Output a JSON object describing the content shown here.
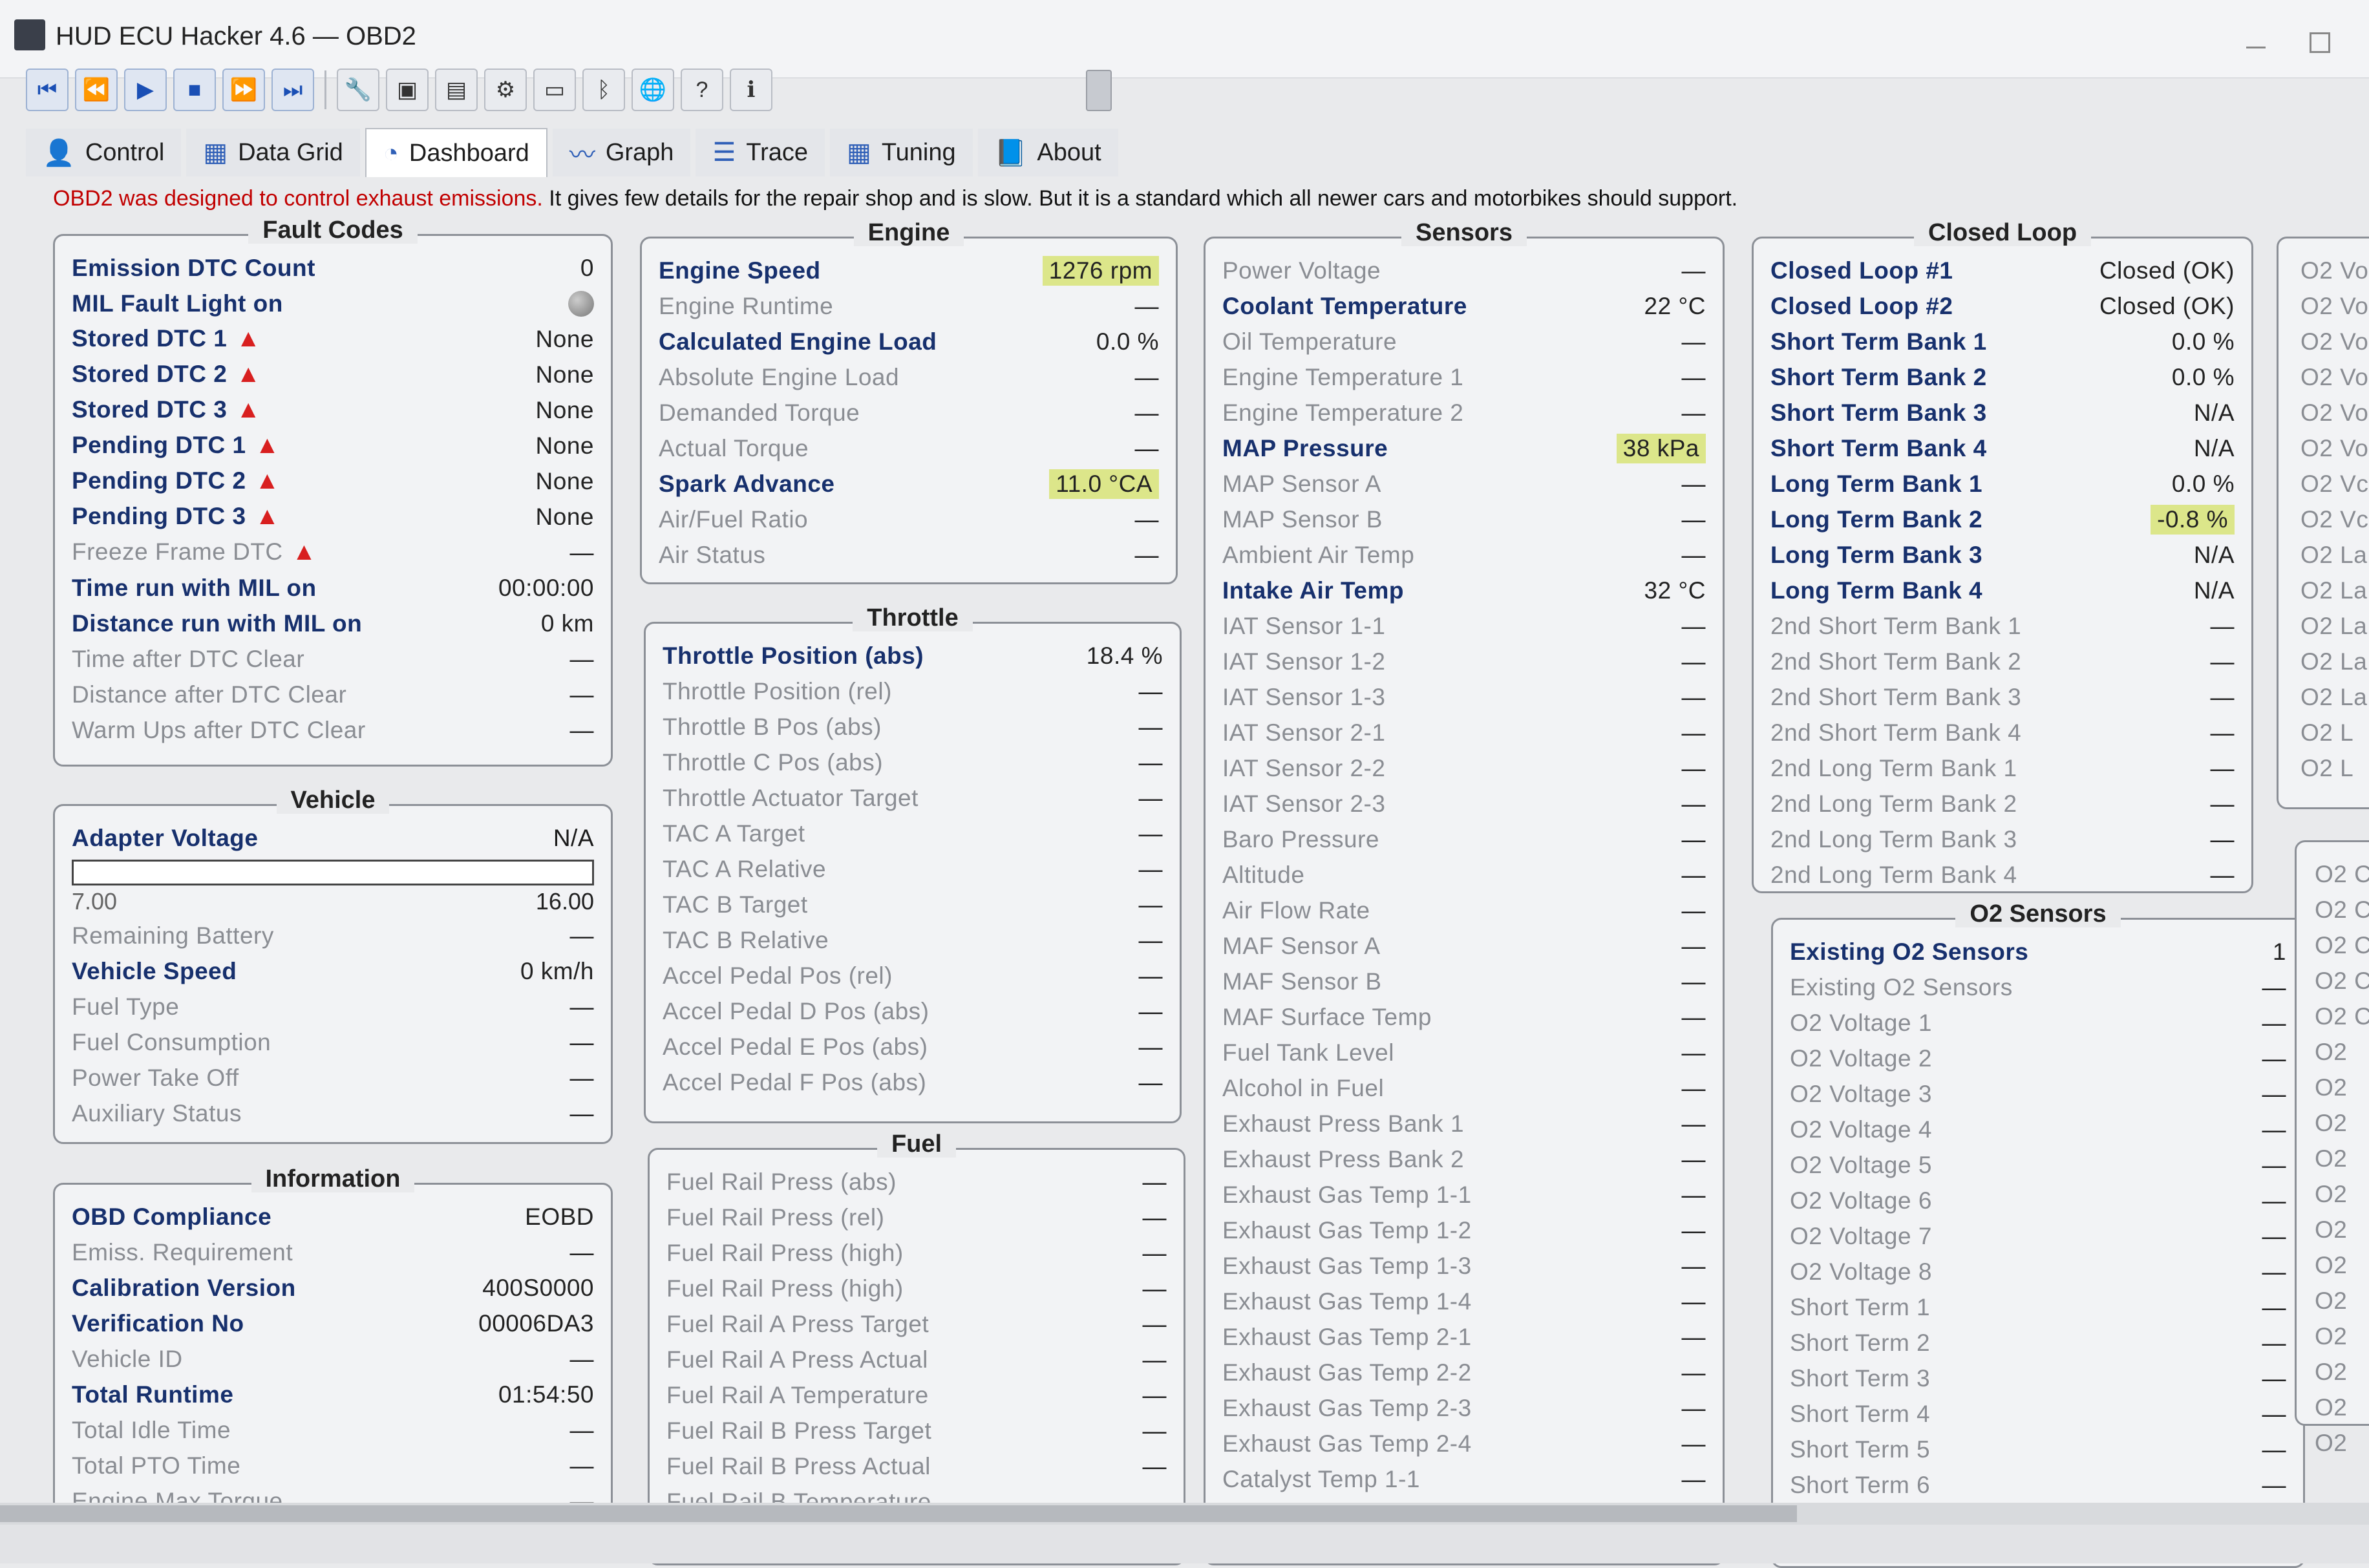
{
  "window": {
    "title": "HUD ECU Hacker 4.6  —  OBD2"
  },
  "toolbar": {
    "buttons": [
      {
        "icon": "skip-first-icon",
        "glyph": "⏮"
      },
      {
        "icon": "rewind-icon",
        "glyph": "⏪"
      },
      {
        "icon": "play-icon",
        "glyph": "▶"
      },
      {
        "icon": "stop-icon",
        "glyph": "■"
      },
      {
        "icon": "fast-forward-icon",
        "glyph": "⏩"
      },
      {
        "icon": "skip-last-icon",
        "glyph": "⏭"
      }
    ],
    "utility_buttons": [
      {
        "icon": "wrench-icon",
        "glyph": "🔧"
      },
      {
        "icon": "terminal-icon",
        "glyph": "▣"
      },
      {
        "icon": "chart-window-icon",
        "glyph": "▤"
      },
      {
        "icon": "gears-icon",
        "glyph": "⚙"
      },
      {
        "icon": "monitor-icon",
        "glyph": "▭"
      },
      {
        "icon": "bluetooth-icon",
        "glyph": "ᛒ"
      },
      {
        "icon": "globe-icon",
        "glyph": "🌐"
      },
      {
        "icon": "help-icon",
        "glyph": "?"
      },
      {
        "icon": "info-icon",
        "glyph": "ℹ"
      }
    ]
  },
  "tabs": [
    {
      "label": "Control",
      "icon": "user-icon",
      "glyph": "👤"
    },
    {
      "label": "Data Grid",
      "icon": "grid-icon",
      "glyph": "▦"
    },
    {
      "label": "Dashboard",
      "icon": "gauge-icon",
      "glyph": "◔"
    },
    {
      "label": "Graph",
      "icon": "graph-icon",
      "glyph": "〰"
    },
    {
      "label": "Trace",
      "icon": "list-icon",
      "glyph": "☰"
    },
    {
      "label": "Tuning",
      "icon": "tuning-grid-icon",
      "glyph": "▦"
    },
    {
      "label": "About",
      "icon": "book-icon",
      "glyph": "📘"
    }
  ],
  "intro": {
    "lead": "OBD2 was designed to control exhaust emissions.",
    "rest": " It gives few details for the repair shop and is slow. But it is a standard which all newer cars and motorbikes should support."
  },
  "colors": {
    "label_bold": "#17306d",
    "highlight": "#dce68a",
    "warning": "#d81f1f"
  },
  "fault_codes": {
    "title": "Fault Codes",
    "rows": [
      {
        "label": "Emission DTC Count",
        "value": "0",
        "bold": true
      },
      {
        "label": "MIL Fault Light on",
        "value": "",
        "bold": true,
        "indicator": "grey-light"
      },
      {
        "label": "Stored DTC 1",
        "value": "None",
        "bold": true,
        "warn": true
      },
      {
        "label": "Stored DTC 2",
        "value": "None",
        "bold": true,
        "warn": true
      },
      {
        "label": "Stored DTC 3",
        "value": "None",
        "bold": true,
        "warn": true
      },
      {
        "label": "Pending DTC 1",
        "value": "None",
        "bold": true,
        "warn": true
      },
      {
        "label": "Pending DTC 2",
        "value": "None",
        "bold": true,
        "warn": true
      },
      {
        "label": "Pending DTC 3",
        "value": "None",
        "bold": true,
        "warn": true
      },
      {
        "label": "Freeze Frame DTC",
        "value": "—",
        "warn": true
      },
      {
        "label": "Time run with MIL on",
        "value": "00:00:00",
        "bold": true
      },
      {
        "label": "Distance run with MIL on",
        "value": "0 km",
        "bold": true
      },
      {
        "label": "Time after DTC Clear",
        "value": "—"
      },
      {
        "label": "Distance after DTC Clear",
        "value": "—"
      },
      {
        "label": "Warm Ups after DTC Clear",
        "value": "—"
      }
    ]
  },
  "vehicle": {
    "title": "Vehicle",
    "adapter_voltage": {
      "label": "Adapter Voltage",
      "value": "N/A",
      "min": "7.00",
      "max": "16.00",
      "level": 0
    },
    "rows": [
      {
        "label": "Remaining Battery",
        "value": "—"
      },
      {
        "label": "Vehicle Speed",
        "value": "0 km/h",
        "bold": true
      },
      {
        "label": "Fuel Type",
        "value": "—"
      },
      {
        "label": "Fuel Consumption",
        "value": "—"
      },
      {
        "label": "Power Take Off",
        "value": "—"
      },
      {
        "label": "Auxiliary Status",
        "value": "—"
      }
    ]
  },
  "information": {
    "title": "Information",
    "rows": [
      {
        "label": "OBD Compliance",
        "value": "EOBD",
        "bold": true
      },
      {
        "label": "Emiss. Requirement",
        "value": "—"
      },
      {
        "label": "Calibration Version",
        "value": "400S0000",
        "bold": true
      },
      {
        "label": "Verification No",
        "value": "00006DA3",
        "bold": true
      },
      {
        "label": "Vehicle ID",
        "value": "—"
      },
      {
        "label": "Total Runtime",
        "value": "01:54:50",
        "bold": true
      },
      {
        "label": "Total Idle Time",
        "value": "—"
      },
      {
        "label": "Total PTO Time",
        "value": "—"
      },
      {
        "label": "Engine Max Torque",
        "value": "—"
      }
    ]
  },
  "engine": {
    "title": "Engine",
    "rows": [
      {
        "label": "Engine Speed",
        "value": "1276 rpm",
        "bold": true,
        "highlight": true
      },
      {
        "label": "Engine Runtime",
        "value": "—"
      },
      {
        "label": "Calculated Engine Load",
        "value": "0.0 %",
        "bold": true
      },
      {
        "label": "Absolute Engine Load",
        "value": "—"
      },
      {
        "label": "Demanded Torque",
        "value": "—"
      },
      {
        "label": "Actual Torque",
        "value": "—"
      },
      {
        "label": "Spark Advance",
        "value": "11.0 °CA",
        "bold": true,
        "highlight": true
      },
      {
        "label": "Air/Fuel Ratio",
        "value": "—"
      },
      {
        "label": "Air Status",
        "value": "—"
      }
    ]
  },
  "throttle": {
    "title": "Throttle",
    "rows": [
      {
        "label": "Throttle Position (abs)",
        "value": "18.4 %",
        "bold": true
      },
      {
        "label": "Throttle Position (rel)",
        "value": "—"
      },
      {
        "label": "Throttle B Pos (abs)",
        "value": "—"
      },
      {
        "label": "Throttle C Pos (abs)",
        "value": "—"
      },
      {
        "label": "Throttle Actuator Target",
        "value": "—"
      },
      {
        "label": "TAC A Target",
        "value": "—"
      },
      {
        "label": "TAC A Relative",
        "value": "—"
      },
      {
        "label": "TAC B Target",
        "value": "—"
      },
      {
        "label": "TAC B Relative",
        "value": "—"
      },
      {
        "label": "Accel Pedal Pos (rel)",
        "value": "—"
      },
      {
        "label": "Accel Pedal D Pos (abs)",
        "value": "—"
      },
      {
        "label": "Accel Pedal E Pos (abs)",
        "value": "—"
      },
      {
        "label": "Accel Pedal F Pos (abs)",
        "value": "—"
      }
    ]
  },
  "fuel": {
    "title": "Fuel",
    "rows": [
      {
        "label": "Fuel Rail Press (abs)",
        "value": "—"
      },
      {
        "label": "Fuel Rail Press (rel)",
        "value": "—"
      },
      {
        "label": "Fuel Rail Press (high)",
        "value": "—"
      },
      {
        "label": "Fuel Rail Press (high)",
        "value": "—"
      },
      {
        "label": "Fuel Rail A Press Target",
        "value": "—"
      },
      {
        "label": "Fuel Rail A Press Actual",
        "value": "—"
      },
      {
        "label": "Fuel Rail A Temperature",
        "value": "—"
      },
      {
        "label": "Fuel Rail B Press Target",
        "value": "—"
      },
      {
        "label": "Fuel Rail B Press Actual",
        "value": "—"
      },
      {
        "label": "Fuel Rail B Temperature",
        "value": "—"
      }
    ]
  },
  "sensors": {
    "title": "Sensors",
    "rows": [
      {
        "label": "Power Voltage",
        "value": "—"
      },
      {
        "label": "Coolant Temperature",
        "value": "22 °C",
        "bold": true
      },
      {
        "label": "Oil Temperature",
        "value": "—"
      },
      {
        "label": "Engine Temperature 1",
        "value": "—"
      },
      {
        "label": "Engine Temperature 2",
        "value": "—"
      },
      {
        "label": "MAP Pressure",
        "value": "38 kPa",
        "bold": true,
        "highlight": true
      },
      {
        "label": "MAP Sensor A",
        "value": "—"
      },
      {
        "label": "MAP Sensor B",
        "value": "—"
      },
      {
        "label": "Ambient Air Temp",
        "value": "—"
      },
      {
        "label": "Intake Air Temp",
        "value": "32 °C",
        "bold": true
      },
      {
        "label": "IAT Sensor 1-1",
        "value": "—"
      },
      {
        "label": "IAT Sensor 1-2",
        "value": "—"
      },
      {
        "label": "IAT Sensor 1-3",
        "value": "—"
      },
      {
        "label": "IAT Sensor 2-1",
        "value": "—"
      },
      {
        "label": "IAT Sensor 2-2",
        "value": "—"
      },
      {
        "label": "IAT Sensor 2-3",
        "value": "—"
      },
      {
        "label": "Baro Pressure",
        "value": "—"
      },
      {
        "label": "Altitude",
        "value": "—"
      },
      {
        "label": "Air Flow Rate",
        "value": "—"
      },
      {
        "label": "MAF Sensor A",
        "value": "—"
      },
      {
        "label": "MAF Sensor B",
        "value": "—"
      },
      {
        "label": "MAF Surface Temp",
        "value": "—"
      },
      {
        "label": "Fuel Tank Level",
        "value": "—"
      },
      {
        "label": "Alcohol in Fuel",
        "value": "—"
      },
      {
        "label": "Exhaust Press Bank 1",
        "value": "—"
      },
      {
        "label": "Exhaust Press Bank 2",
        "value": "—"
      },
      {
        "label": "Exhaust Gas Temp 1-1",
        "value": "—"
      },
      {
        "label": "Exhaust Gas Temp 1-2",
        "value": "—"
      },
      {
        "label": "Exhaust Gas Temp 1-3",
        "value": "—"
      },
      {
        "label": "Exhaust Gas Temp 1-4",
        "value": "—"
      },
      {
        "label": "Exhaust Gas Temp 2-1",
        "value": "—"
      },
      {
        "label": "Exhaust Gas Temp 2-2",
        "value": "—"
      },
      {
        "label": "Exhaust Gas Temp 2-3",
        "value": "—"
      },
      {
        "label": "Exhaust Gas Temp 2-4",
        "value": "—"
      },
      {
        "label": "Catalyst Temp 1-1",
        "value": "—"
      }
    ]
  },
  "closed_loop": {
    "title": "Closed Loop",
    "rows": [
      {
        "label": "Closed Loop #1",
        "value": "Closed (OK)",
        "bold": true
      },
      {
        "label": "Closed Loop #2",
        "value": "Closed (OK)",
        "bold": true
      },
      {
        "label": "Short Term Bank 1",
        "value": "0.0 %",
        "bold": true
      },
      {
        "label": "Short Term Bank 2",
        "value": "0.0 %",
        "bold": true
      },
      {
        "label": "Short Term Bank 3",
        "value": "N/A",
        "bold": true
      },
      {
        "label": "Short Term Bank 4",
        "value": "N/A",
        "bold": true
      },
      {
        "label": "Long Term Bank 1",
        "value": "0.0 %",
        "bold": true
      },
      {
        "label": "Long Term Bank 2",
        "value": "-0.8 %",
        "bold": true,
        "highlight": true
      },
      {
        "label": "Long Term Bank 3",
        "value": "N/A",
        "bold": true
      },
      {
        "label": "Long Term Bank 4",
        "value": "N/A",
        "bold": true
      },
      {
        "label": "2nd Short Term Bank 1",
        "value": "—"
      },
      {
        "label": "2nd Short Term Bank 2",
        "value": "—"
      },
      {
        "label": "2nd Short Term Bank 3",
        "value": "—"
      },
      {
        "label": "2nd Short Term Bank 4",
        "value": "—"
      },
      {
        "label": "2nd Long Term Bank 1",
        "value": "—"
      },
      {
        "label": "2nd Long Term Bank 2",
        "value": "—"
      },
      {
        "label": "2nd Long Term Bank 3",
        "value": "—"
      },
      {
        "label": "2nd Long Term Bank 4",
        "value": "—"
      }
    ]
  },
  "o2_sensors": {
    "title": "O2 Sensors",
    "rows": [
      {
        "label": "Existing O2 Sensors",
        "value": "1",
        "bold": true
      },
      {
        "label": "Existing O2 Sensors",
        "value": "—"
      },
      {
        "label": "O2 Voltage 1",
        "value": "—"
      },
      {
        "label": "O2 Voltage 2",
        "value": "—"
      },
      {
        "label": "O2 Voltage 3",
        "value": "—"
      },
      {
        "label": "O2 Voltage 4",
        "value": "—"
      },
      {
        "label": "O2 Voltage 5",
        "value": "—"
      },
      {
        "label": "O2 Voltage 6",
        "value": "—"
      },
      {
        "label": "O2 Voltage 7",
        "value": "—"
      },
      {
        "label": "O2 Voltage 8",
        "value": "—"
      },
      {
        "label": "Short Term 1",
        "value": "—"
      },
      {
        "label": "Short Term 2",
        "value": "—"
      },
      {
        "label": "Short Term 3",
        "value": "—"
      },
      {
        "label": "Short Term 4",
        "value": "—"
      },
      {
        "label": "Short Term 5",
        "value": "—"
      },
      {
        "label": "Short Term 6",
        "value": "—"
      }
    ]
  },
  "partial_panel_top": {
    "rows": [
      "O2 Vol",
      "O2 Vol",
      "O2 Vo",
      "O2 Vo",
      "O2 Vo",
      "O2 Vo",
      "O2 Vc",
      "O2 Vc",
      "O2 La",
      "O2 La",
      "O2 La",
      "O2 La",
      "O2 La",
      "O2 L",
      "O2 L"
    ]
  },
  "partial_panel_bottom": {
    "rows": [
      "O2 C",
      "O2 C",
      "O2 C",
      "O2 C",
      "O2 C",
      "O2",
      "O2",
      "O2",
      "O2",
      "O2",
      "O2",
      "O2",
      "O2",
      "O2",
      "O2",
      "O2",
      "O2"
    ]
  }
}
